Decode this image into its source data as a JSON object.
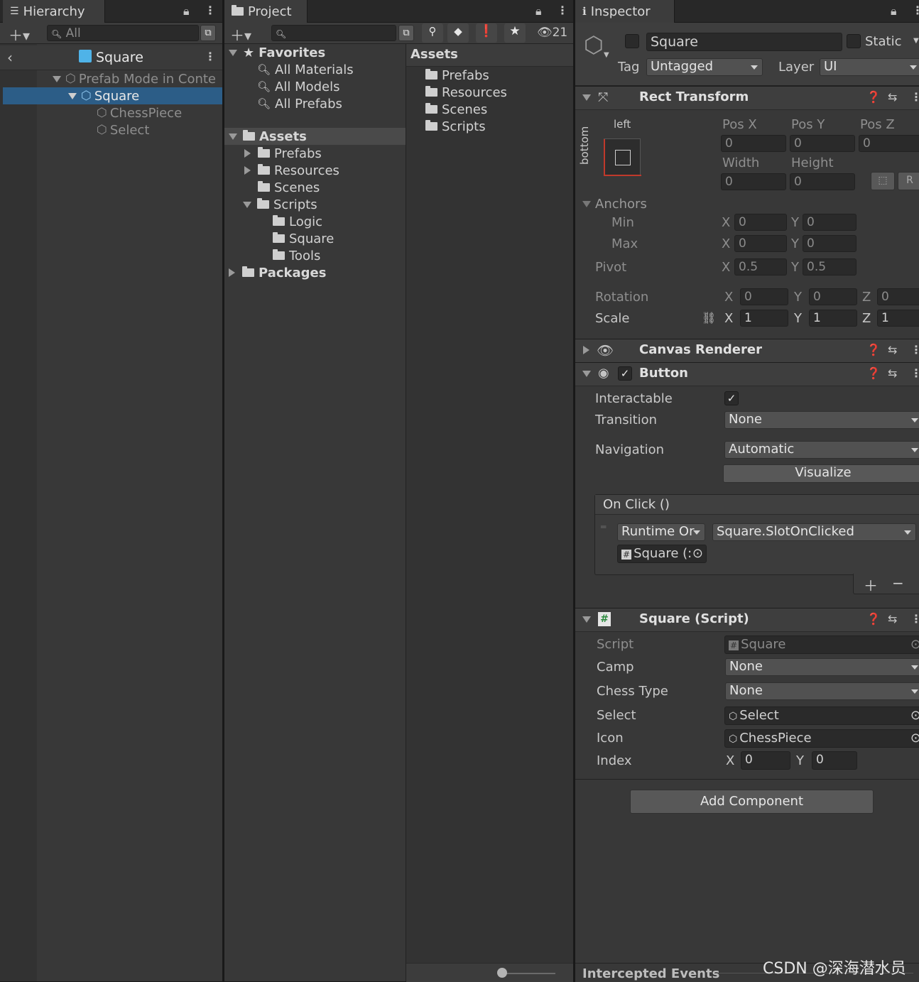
{
  "hierarchy": {
    "tab_label": "Hierarchy",
    "search_placeholder": "All",
    "header_title": "Square",
    "items": [
      {
        "label": "Prefab Mode in Conte"
      },
      {
        "label": "Square"
      },
      {
        "label": "ChessPiece"
      },
      {
        "label": "Select"
      }
    ]
  },
  "project": {
    "tab_label": "Project",
    "hidden_count": "21",
    "favorites": {
      "label": "Favorites",
      "items": [
        "All Materials",
        "All Models",
        "All Prefabs"
      ]
    },
    "assets_tree": {
      "label": "Assets",
      "items": [
        "Prefabs",
        "Resources",
        "Scenes",
        "Scripts"
      ],
      "script_children": [
        "Logic",
        "Square",
        "Tools"
      ]
    },
    "packages_label": "Packages",
    "right_header": "Assets",
    "right_items": [
      "Prefabs",
      "Resources",
      "Scenes",
      "Scripts"
    ]
  },
  "inspector": {
    "tab_label": "Inspector",
    "object_name": "Square",
    "static_label": "Static",
    "tag_label": "Tag",
    "tag_value": "Untagged",
    "layer_label": "Layer",
    "layer_value": "UI",
    "rect_transform": {
      "title": "Rect Transform",
      "anchor_preset_h": "left",
      "anchor_preset_v": "bottom",
      "posx_label": "Pos X",
      "posy_label": "Pos Y",
      "posz_label": "Pos Z",
      "posx": "0",
      "posy": "0",
      "posz": "0",
      "width_label": "Width",
      "height_label": "Height",
      "width": "0",
      "height": "0",
      "anchors_label": "Anchors",
      "min_label": "Min",
      "max_label": "Max",
      "pivot_label": "Pivot",
      "x_label": "X",
      "y_label": "Y",
      "z_label": "Z",
      "min_x": "0",
      "min_y": "0",
      "max_x": "0",
      "max_y": "0",
      "pivot_x": "0.5",
      "pivot_y": "0.5",
      "rotation_label": "Rotation",
      "rot_x": "0",
      "rot_y": "0",
      "rot_z": "0",
      "scale_label": "Scale",
      "scale_x": "1",
      "scale_y": "1",
      "scale_z": "1",
      "raw_button": "R"
    },
    "canvas_renderer": {
      "title": "Canvas Renderer"
    },
    "button": {
      "title": "Button",
      "interactable_label": "Interactable",
      "transition_label": "Transition",
      "transition_value": "None",
      "navigation_label": "Navigation",
      "navigation_value": "Automatic",
      "visualize_label": "Visualize",
      "onclick_label": "On Click ()",
      "runtime_value": "Runtime Or",
      "function_value": "Square.SlotOnClicked",
      "target_value": "Square (:"
    },
    "square_script": {
      "title": "Square (Script)",
      "script_label": "Script",
      "script_value": "Square",
      "camp_label": "Camp",
      "camp_value": "None",
      "chess_type_label": "Chess Type",
      "chess_type_value": "None",
      "select_label": "Select",
      "select_value": "Select",
      "icon_label": "Icon",
      "icon_value": "ChessPiece",
      "index_label": "Index",
      "index_x": "0",
      "index_y": "0",
      "x_label": "X",
      "y_label": "Y"
    },
    "add_component_label": "Add Component",
    "intercepted_events_label": "Intercepted Events"
  },
  "watermark": "CSDN @深海潜水员",
  "colors": {
    "selection": "#2c5d87",
    "panel": "#383838",
    "tabbar": "#282828"
  }
}
